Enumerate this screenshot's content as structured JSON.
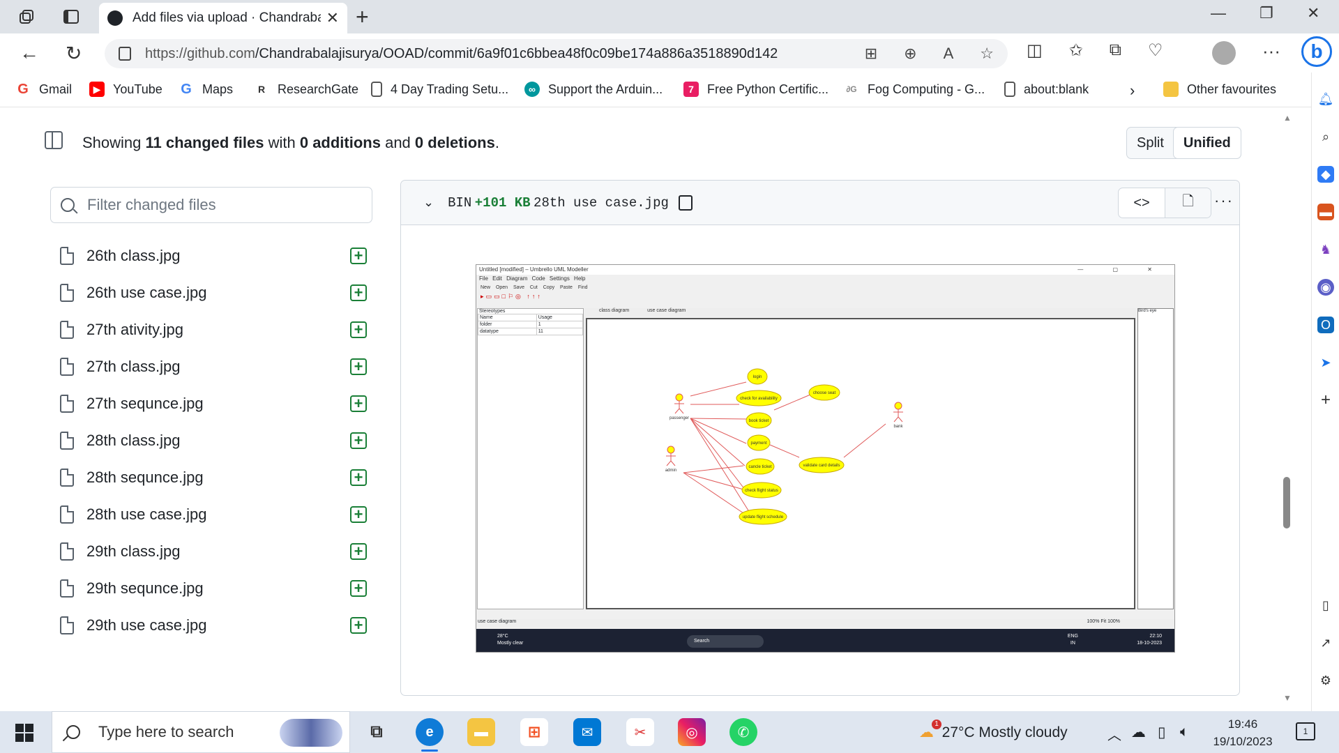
{
  "browser": {
    "tab_title": "Add files via upload · Chandrabal",
    "url_domain": "https://github.com",
    "url_path": "/Chandrabalajisurya/OOAD/commit/6a9f01c6bbea48f0c09be174a886a3518890d142",
    "favorites": [
      {
        "label": "Gmail",
        "icon": "gmail-icon",
        "color": "#ea4335"
      },
      {
        "label": "YouTube",
        "icon": "youtube-icon",
        "color": "#ff0000"
      },
      {
        "label": "Maps",
        "icon": "google-icon",
        "color": "#4285f4"
      },
      {
        "label": "ResearchGate",
        "icon": "researchgate-icon",
        "color": "#333333"
      },
      {
        "label": "4 Day Trading Setu...",
        "icon": "page-icon",
        "color": "#555555"
      },
      {
        "label": "Support the Arduin...",
        "icon": "arduino-icon",
        "color": "#00979d"
      },
      {
        "label": "Free Python Certific...",
        "icon": "python-cert-icon",
        "color": "#e91e63"
      },
      {
        "label": "Fog Computing - G...",
        "icon": "fog-icon",
        "color": "#888888"
      },
      {
        "label": "about:blank",
        "icon": "page-icon",
        "color": "#555555"
      }
    ],
    "other_favourites": "Other favourites"
  },
  "summary": {
    "prefix": "Showing ",
    "files": "11 changed files",
    "mid1": " with ",
    "additions": "0 additions",
    "mid2": " and ",
    "deletions": "0 deletions",
    "suffix": "."
  },
  "view_toggle": {
    "split": "Split",
    "unified": "Unified",
    "selected": "Unified"
  },
  "filter": {
    "placeholder": "Filter changed files"
  },
  "files": [
    "26th class.jpg",
    "26th use case.jpg",
    "27th ativity.jpg",
    "27th class.jpg",
    "27th sequnce.jpg",
    "28th class.jpg",
    "28th sequnce.jpg",
    "28th use case.jpg",
    "29th class.jpg",
    "29th sequnce.jpg",
    "29th use case.jpg"
  ],
  "diff": {
    "bin": "BIN",
    "size": "+101 KB",
    "filename": "28th use case.jpg"
  },
  "embedded_image": {
    "window_title": "Untitled [modified] – Umbrello UML Modeller",
    "menu": "File Edit Diagram Code Settings Help",
    "toolbar": "New Open Save Cut Copy Paste Find",
    "panel_title": "Stereotypes",
    "table_headers": [
      "Name",
      "Usage"
    ],
    "table_rows": [
      [
        "folder",
        "1"
      ],
      [
        "datatype",
        "11"
      ]
    ],
    "tabs": [
      "class diagram",
      "use case diagram"
    ],
    "right_panel": "Bird's eye",
    "status": "use case diagram",
    "zoom": "100%  Fit  100%",
    "actors": [
      "passenger",
      "admin",
      "bank"
    ],
    "use_cases": [
      "login",
      "check for availability",
      "choose seat",
      "book ticket",
      "payment",
      "cancle ticket",
      "validate card details",
      "check flight status",
      "update flight schedule"
    ],
    "taskbar": {
      "temp": "28°C",
      "weather": "Mostly clear",
      "search": "Search",
      "lang": "ENG",
      "region": "IN",
      "time": "22:10",
      "date": "18-10-2023"
    }
  },
  "taskbar": {
    "search_placeholder": "Type here to search",
    "weather": "27°C  Mostly cloudy",
    "time": "19:46",
    "date": "19/10/2023",
    "notifications": "1",
    "weather_badge": "1"
  }
}
